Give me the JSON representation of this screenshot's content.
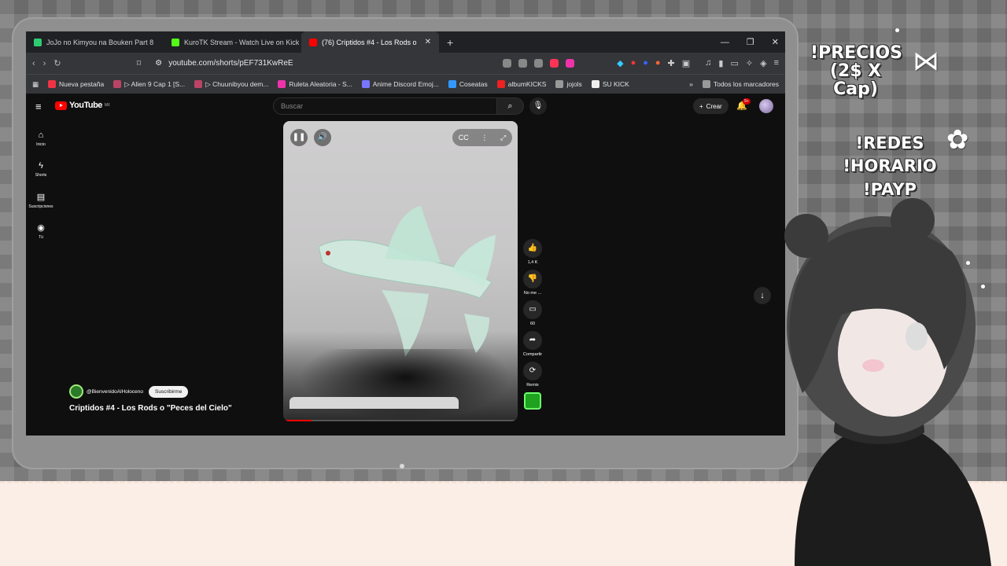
{
  "browser": {
    "tabs": [
      {
        "label": "JoJo no Kimyou na Bouken Part 8",
        "fav_color": "#2ecc71"
      },
      {
        "label": "KuroTK Stream - Watch Live on Kick",
        "fav_color": "#53fc18"
      },
      {
        "label": "(76) Críptidos #4 - Los Rods o",
        "fav_color": "#ff0000"
      }
    ],
    "new_tab": "+",
    "url": "youtube.com/shorts/pEF731KwReE",
    "bookmarks": [
      {
        "label": "Nueva pestaña",
        "color": "#e34"
      },
      {
        "label": "▷ Alien 9 Cap 1 [S...",
        "color": "#b46"
      },
      {
        "label": "▷ Chuunibyou dem...",
        "color": "#b46"
      },
      {
        "label": "Ruleta Aleatoria - S...",
        "color": "#e3a"
      },
      {
        "label": "Anime Discord Emoj...",
        "color": "#77f"
      },
      {
        "label": "Coseatas",
        "color": "#39f"
      },
      {
        "label": "albumKICKS",
        "color": "#e22"
      },
      {
        "label": "jojols",
        "color": "#999"
      },
      {
        "label": "SU KICK",
        "color": "#eee"
      }
    ],
    "all_bookmarks": "Todos los marcadores"
  },
  "youtube": {
    "logo": "YouTube",
    "region": "MX",
    "search_placeholder": "Buscar",
    "create_label": "Crear",
    "bell_badge": "9+",
    "sidebar": [
      {
        "icon": "⌂",
        "label": "Inicio"
      },
      {
        "icon": "ϟ",
        "label": "Shorts"
      },
      {
        "icon": "▤",
        "label": "Suscripciones"
      },
      {
        "icon": "◉",
        "label": "Tú"
      }
    ],
    "actions": [
      {
        "icon": "👍",
        "label": "1,4 K"
      },
      {
        "icon": "👎",
        "label": "No me ..."
      },
      {
        "icon": "▭",
        "label": "60"
      },
      {
        "icon": "➦",
        "label": "Compartir"
      },
      {
        "icon": "⟳",
        "label": "Remix"
      }
    ],
    "channel": "@BienvenidoAlHoloceno",
    "subscribe_label": "Suscribirme",
    "video_title": "Criptidos #4 - Los Rods o \"Peces del Cielo\"",
    "progress": 0.12
  },
  "overlay": {
    "command1": "!PRECIOS\n(2$ X Cap)",
    "command2": "!REDES\n!HORARIO\n!PAYP"
  }
}
